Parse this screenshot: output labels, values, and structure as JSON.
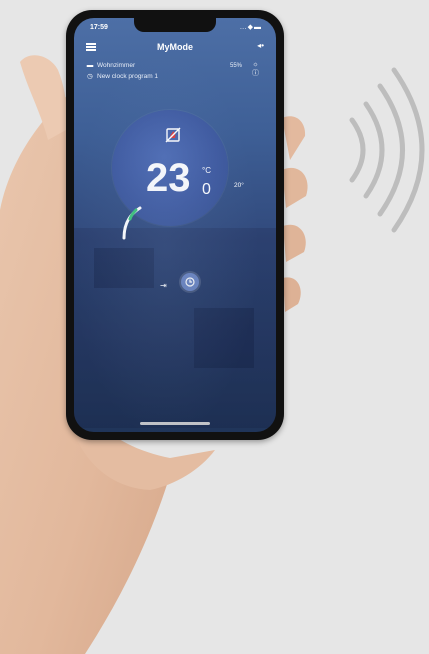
{
  "status_bar": {
    "time": "17:59",
    "icons": "…◆▬"
  },
  "header": {
    "title": "MyMode",
    "menu_icon": "hamburger-icon",
    "back_icon": "back-icon"
  },
  "room": {
    "name": "Wohnzimmer",
    "humidity": "55%"
  },
  "program": {
    "name": "New clock program 1"
  },
  "thermostat": {
    "temperature_main": "23",
    "temperature_decimal": "0",
    "unit": "°C",
    "side_value": "20°"
  },
  "colors": {
    "screen_top": "#4d6fa6",
    "dial": "#3f5aa0",
    "clock_button": "#6d87c4",
    "background": "#e6e6e6"
  }
}
